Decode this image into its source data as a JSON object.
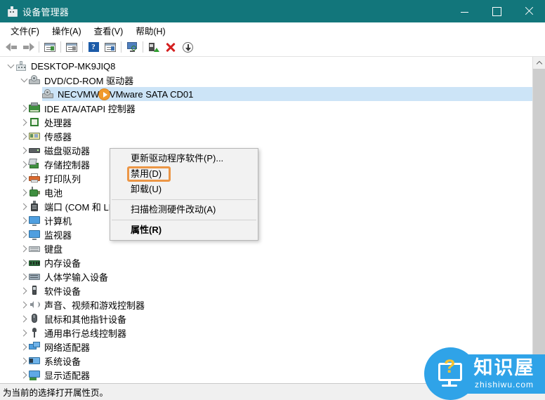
{
  "window": {
    "title": "设备管理器",
    "title_icon": "device-manager-icon",
    "accent_color": "#12767b",
    "minimize_label": "最小化",
    "maximize_label": "最大化",
    "close_label": "关闭"
  },
  "menubar": {
    "items": [
      {
        "label": "文件(F)"
      },
      {
        "label": "操作(A)"
      },
      {
        "label": "查看(V)"
      },
      {
        "label": "帮助(H)"
      }
    ]
  },
  "toolbar": {
    "buttons": [
      {
        "name": "back-arrow-icon",
        "tooltip": "后退"
      },
      {
        "name": "forward-arrow-icon",
        "tooltip": "前进"
      },
      {
        "name": "properties-window-icon",
        "tooltip": "属性"
      },
      {
        "name": "console-window-icon",
        "tooltip": "显示/隐藏控制台树"
      },
      {
        "name": "help-icon",
        "tooltip": "帮助",
        "glyph": "?"
      },
      {
        "name": "show-hidden-window-icon",
        "tooltip": "显示隐藏的设备"
      },
      {
        "name": "scan-hardware-icon",
        "tooltip": "扫描检测硬件改动"
      },
      {
        "name": "update-driver-icon",
        "tooltip": "更新驱动程序软件"
      },
      {
        "name": "uninstall-icon",
        "tooltip": "卸载"
      },
      {
        "name": "enable-device-icon",
        "tooltip": "启用设备"
      }
    ]
  },
  "tree": {
    "nodes": [
      {
        "label": "DESKTOP-MK9JIQ8",
        "level": 0,
        "state": "expanded",
        "icon": "computer-icon",
        "selected": false
      },
      {
        "label": "DVD/CD-ROM 驱动器",
        "level": 1,
        "state": "expanded",
        "icon": "dvd-drive-icon",
        "selected": false
      },
      {
        "label": "NECVMWar VMware SATA CD01",
        "level": 2,
        "state": "leaf",
        "icon": "dvd-drive-icon",
        "selected": true
      },
      {
        "label": "IDE ATA/ATAPI 控制器",
        "level": 1,
        "state": "collapsed",
        "icon": "ide-controller-icon",
        "selected": false
      },
      {
        "label": "处理器",
        "level": 1,
        "state": "collapsed",
        "icon": "processor-icon",
        "selected": false
      },
      {
        "label": "传感器",
        "level": 1,
        "state": "collapsed",
        "icon": "sensor-icon",
        "selected": false
      },
      {
        "label": "磁盘驱动器",
        "level": 1,
        "state": "collapsed",
        "icon": "disk-drive-icon",
        "selected": false
      },
      {
        "label": "存储控制器",
        "level": 1,
        "state": "collapsed",
        "icon": "storage-controller-icon",
        "selected": false
      },
      {
        "label": "打印队列",
        "level": 1,
        "state": "collapsed",
        "icon": "print-queue-icon",
        "selected": false
      },
      {
        "label": "电池",
        "level": 1,
        "state": "collapsed",
        "icon": "battery-icon",
        "selected": false
      },
      {
        "label": "端口 (COM 和 LPT)",
        "level": 1,
        "state": "collapsed",
        "icon": "port-icon",
        "selected": false
      },
      {
        "label": "计算机",
        "level": 1,
        "state": "collapsed",
        "icon": "monitor-icon",
        "selected": false
      },
      {
        "label": "监视器",
        "level": 1,
        "state": "collapsed",
        "icon": "monitor-icon",
        "selected": false
      },
      {
        "label": "键盘",
        "level": 1,
        "state": "collapsed",
        "icon": "keyboard-icon",
        "selected": false
      },
      {
        "label": "内存设备",
        "level": 1,
        "state": "collapsed",
        "icon": "memory-icon",
        "selected": false
      },
      {
        "label": "人体学输入设备",
        "level": 1,
        "state": "collapsed",
        "icon": "hid-icon",
        "selected": false
      },
      {
        "label": "软件设备",
        "level": 1,
        "state": "collapsed",
        "icon": "software-device-icon",
        "selected": false
      },
      {
        "label": "声音、视频和游戏控制器",
        "level": 1,
        "state": "collapsed",
        "icon": "sound-icon",
        "selected": false
      },
      {
        "label": "鼠标和其他指针设备",
        "level": 1,
        "state": "collapsed",
        "icon": "mouse-icon",
        "selected": false
      },
      {
        "label": "通用串行总线控制器",
        "level": 1,
        "state": "collapsed",
        "icon": "usb-icon",
        "selected": false
      },
      {
        "label": "网络适配器",
        "level": 1,
        "state": "collapsed",
        "icon": "network-adapter-icon",
        "selected": false
      },
      {
        "label": "系统设备",
        "level": 1,
        "state": "collapsed",
        "icon": "system-device-icon",
        "selected": false
      },
      {
        "label": "显示适配器",
        "level": 1,
        "state": "collapsed",
        "icon": "display-adapter-icon",
        "selected": false
      }
    ]
  },
  "context_menu": {
    "items": [
      {
        "label": "更新驱动程序软件(P)...",
        "type": "item",
        "bold": false,
        "highlighted": false
      },
      {
        "label": "禁用(D)",
        "type": "item",
        "bold": false,
        "highlighted": true
      },
      {
        "label": "卸载(U)",
        "type": "item",
        "bold": false,
        "highlighted": false
      },
      {
        "label": "",
        "type": "separator",
        "bold": false,
        "highlighted": false
      },
      {
        "label": "扫描检测硬件改动(A)",
        "type": "item",
        "bold": false,
        "highlighted": false
      },
      {
        "label": "",
        "type": "separator",
        "bold": false,
        "highlighted": false
      },
      {
        "label": "属性(R)",
        "type": "item",
        "bold": true,
        "highlighted": false
      }
    ],
    "highlight_color": "#ec9646"
  },
  "statusbar": {
    "text": "为当前的选择打开属性页。"
  },
  "watermark": {
    "brand": "知识屋",
    "url": "zhishiwu.com",
    "question_mark": "?",
    "color": "#2fa3e8"
  }
}
